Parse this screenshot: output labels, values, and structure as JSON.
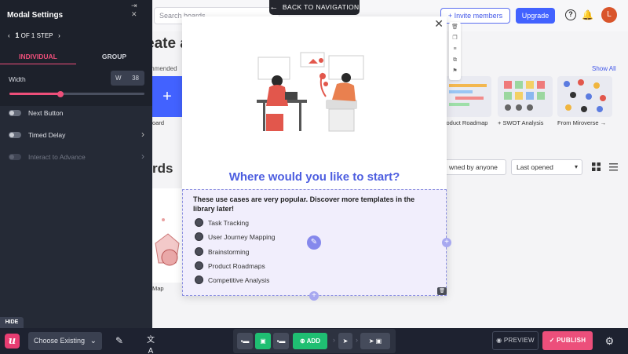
{
  "background": {
    "search_placeholder": "Search boards",
    "invite_label": "Invite members",
    "upgrade_label": "Upgrade",
    "avatar_initial": "L",
    "heading_fragment": "eate a",
    "recommended_fragment": "mmended",
    "show_all": "Show All",
    "cards": [
      {
        "label": "oard"
      },
      {
        "label": "roduct Roadmap"
      },
      {
        "label": "+ SWOT Analysis"
      },
      {
        "label": "From Miroverse →"
      }
    ],
    "boards_fragment": "rds",
    "owned_select": "wned by anyone",
    "sort_select": "Last opened",
    "board_card_label": "Map"
  },
  "back_nav": "BACK TO NAVIGATION",
  "panel": {
    "title": "Modal Settings",
    "step_current": "1",
    "step_text": "OF 1 STEP",
    "tabs": [
      "INDIVIDUAL",
      "GROUP"
    ],
    "width_label": "Width",
    "width_prefix": "W",
    "width_value": "38",
    "width_slider_fraction": 0.38,
    "rows": [
      {
        "label": "Next Button",
        "enabled": true,
        "chevron": false
      },
      {
        "label": "Timed Delay",
        "enabled": true,
        "chevron": true
      },
      {
        "label": "Interact to Advance",
        "enabled": false,
        "chevron": true
      }
    ],
    "hide_label": "HIDE"
  },
  "modal": {
    "heading": "Where would you like to start?",
    "intro": "These use cases are very popular. Discover more templates in the library later!",
    "options": [
      "Task Tracking",
      "User Journey Mapping",
      "Brainstorming",
      "Product Roadmaps",
      "Competitive Analysis"
    ]
  },
  "bottom": {
    "choose_label": "Choose Existing",
    "add_label": "ADD",
    "preview_label": "PREVIEW",
    "publish_label": "PUBLISH"
  },
  "colors": {
    "accent_pink": "#ec4f7b",
    "modal_heading": "#4d5ee0",
    "add_green": "#1fbf72",
    "panel_bg": "#252a36"
  }
}
